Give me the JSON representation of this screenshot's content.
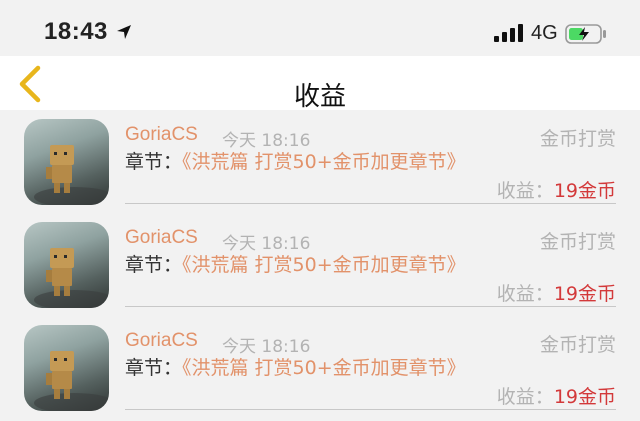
{
  "status_bar": {
    "time": "18:43",
    "network": "4G",
    "icons": [
      "location-arrow-icon",
      "signal-icon",
      "battery-charging-icon"
    ],
    "battery_color": "#4cd964"
  },
  "nav": {
    "title": "收益",
    "back_icon": "chevron-left-icon",
    "back_color": "#e8b61c"
  },
  "records": [
    {
      "avatar": "cardboard-robot-avatar",
      "user": "GoriaCS",
      "time": "今天 18:16",
      "type": "金币打赏",
      "chapter_label": "章节：",
      "chapter_title": "《洪荒篇 打赏50+金币加更章节》",
      "income_label": "收益：",
      "income_value": "19金币"
    },
    {
      "avatar": "cardboard-robot-avatar",
      "user": "GoriaCS",
      "time": "今天 18:16",
      "type": "金币打赏",
      "chapter_label": "章节：",
      "chapter_title": "《洪荒篇 打赏50+金币加更章节》",
      "income_label": "收益：",
      "income_value": "19金币"
    },
    {
      "avatar": "cardboard-robot-avatar",
      "user": "GoriaCS",
      "time": "今天 18:16",
      "type": "金币打赏",
      "chapter_label": "章节：",
      "chapter_title": "《洪荒篇 打赏50+金币加更章节》",
      "income_label": "收益：",
      "income_value": "19金币"
    }
  ],
  "colors": {
    "accent": "#e2926a",
    "income": "#d3393a",
    "muted": "#b3b3b3"
  }
}
